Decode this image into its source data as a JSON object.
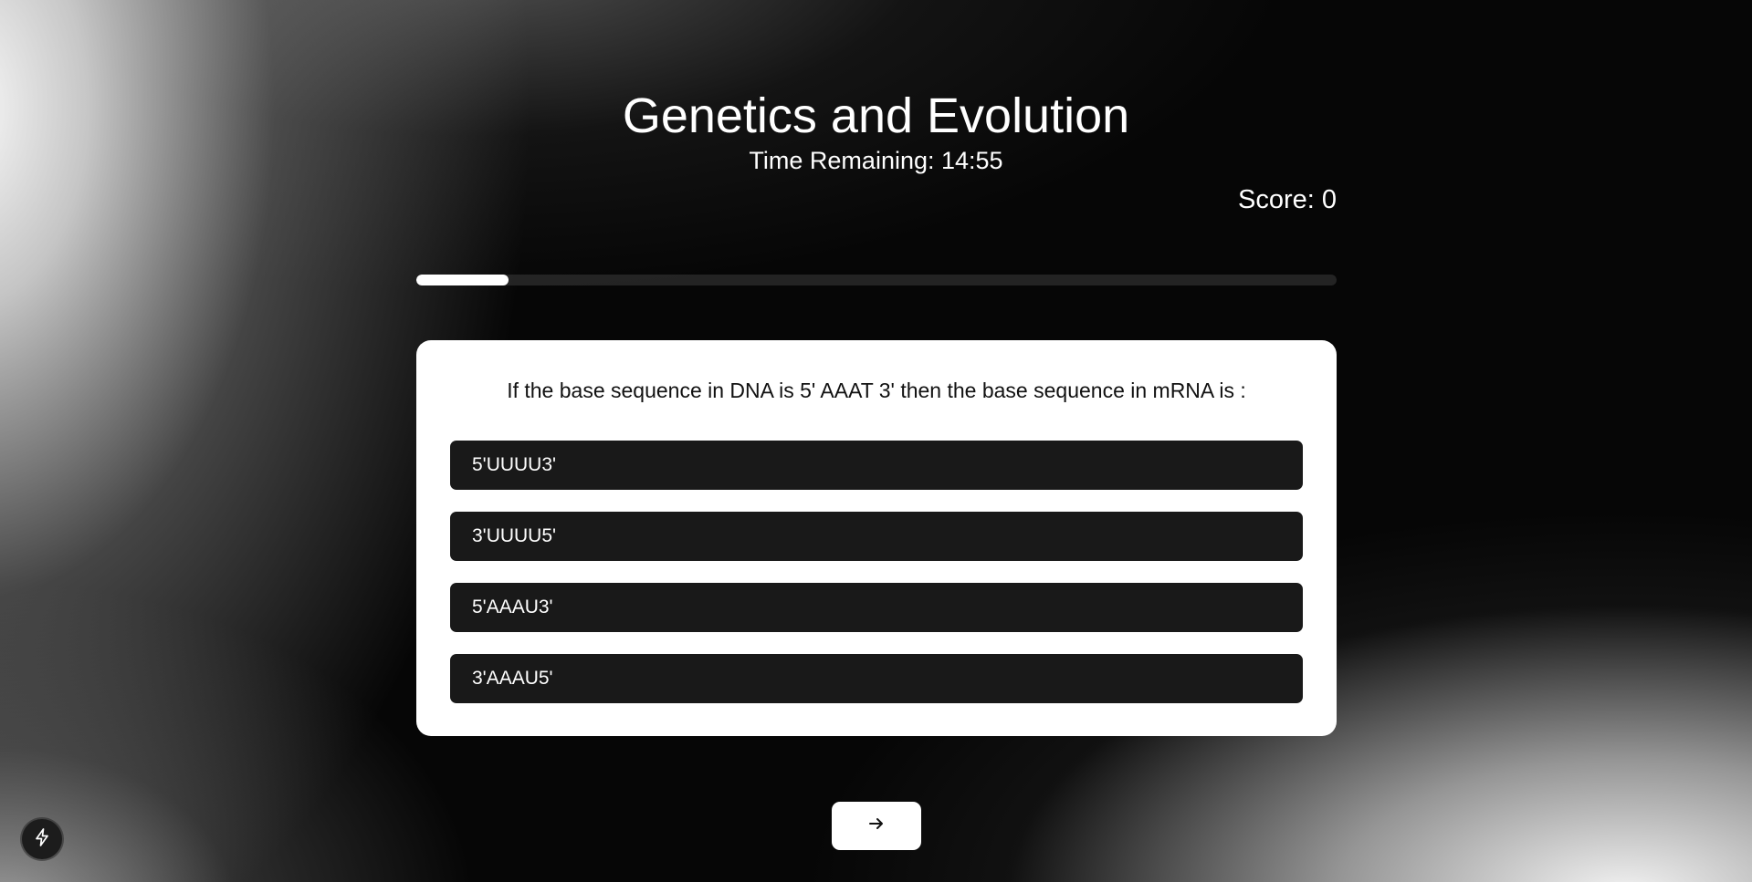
{
  "quiz": {
    "title": "Genetics and Evolution",
    "timer_text": "Time Remaining: 14:55",
    "score_text": "Score: 0",
    "progress_fraction": 0.1
  },
  "question": {
    "text": "If the base sequence in DNA is 5' AAAT 3' then the base sequence in mRNA is :",
    "options": [
      "5'UUUU3'",
      "3'UUUU5'",
      "5'AAAU3'",
      "3'AAAU5'"
    ]
  },
  "controls": {
    "next_icon": "arrow-right-icon",
    "badge_icon": "lightning-icon"
  },
  "colors": {
    "card_background": "#ffffff",
    "option_background": "#191919",
    "progress_fill": "#ffffff"
  }
}
